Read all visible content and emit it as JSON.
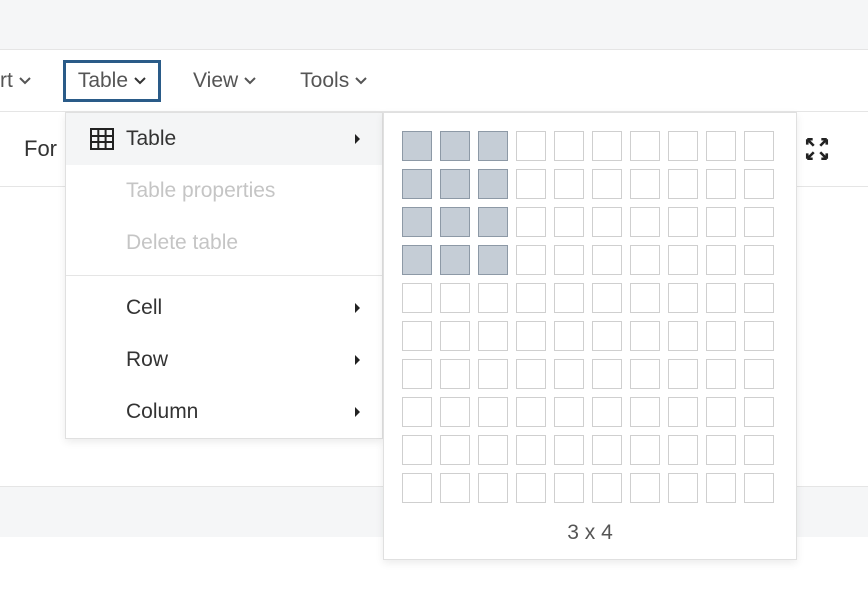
{
  "menubar": {
    "partial_item": "rt",
    "items": [
      {
        "label": "Table",
        "active": true
      },
      {
        "label": "View",
        "active": false
      },
      {
        "label": "Tools",
        "active": false
      }
    ]
  },
  "toolbar": {
    "partial_label": "For"
  },
  "dropdown": {
    "table": "Table",
    "table_properties": "Table properties",
    "delete_table": "Delete table",
    "cell": "Cell",
    "row": "Row",
    "column": "Column"
  },
  "grid_picker": {
    "rows_total": 10,
    "cols_total": 10,
    "selected_cols": 3,
    "selected_rows": 4,
    "caption": "3 x 4"
  }
}
